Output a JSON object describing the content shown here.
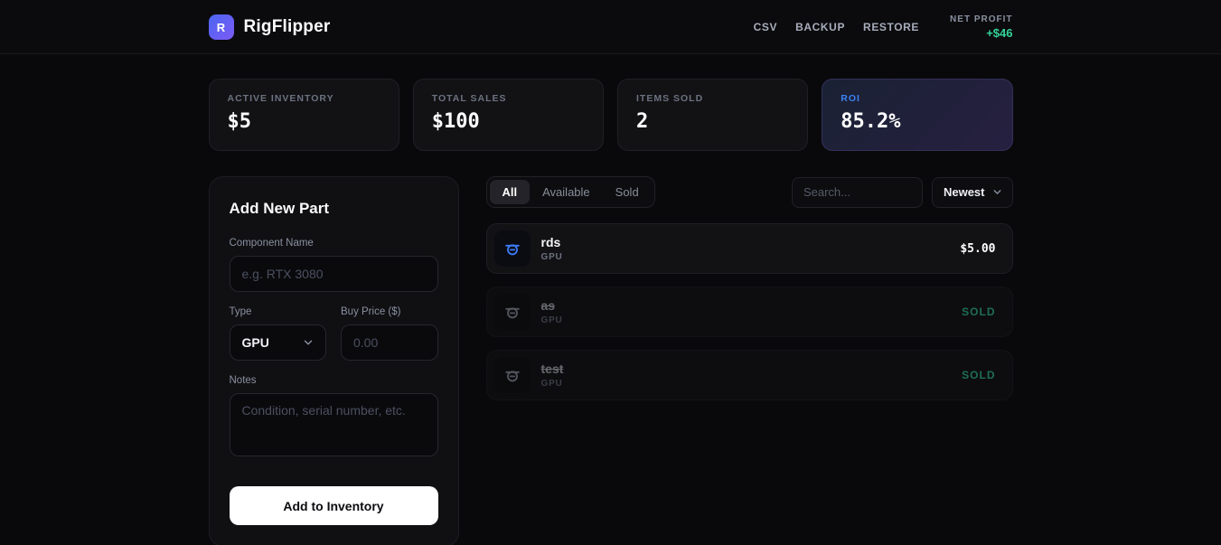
{
  "header": {
    "logo_letter": "R",
    "app_name": "RigFlipper",
    "nav": [
      {
        "label": "CSV"
      },
      {
        "label": "BACKUP"
      },
      {
        "label": "RESTORE"
      }
    ],
    "net_profit": {
      "label": "NET PROFIT",
      "value": "+$46"
    }
  },
  "stats": [
    {
      "label": "ACTIVE INVENTORY",
      "value": "$5"
    },
    {
      "label": "TOTAL SALES",
      "value": "$100"
    },
    {
      "label": "ITEMS SOLD",
      "value": "2"
    },
    {
      "label": "ROI",
      "value": "85.2%"
    }
  ],
  "form": {
    "title": "Add New Part",
    "component_name": {
      "label": "Component Name",
      "placeholder": "e.g. RTX 3080",
      "value": ""
    },
    "type": {
      "label": "Type",
      "value": "GPU"
    },
    "buy_price": {
      "label": "Buy Price ($)",
      "placeholder": "0.00",
      "value": ""
    },
    "notes": {
      "label": "Notes",
      "placeholder": "Condition, serial number, etc.",
      "value": ""
    },
    "submit_label": "Add to Inventory"
  },
  "list": {
    "tabs": [
      {
        "label": "All"
      },
      {
        "label": "Available"
      },
      {
        "label": "Sold"
      }
    ],
    "active_tab": "All",
    "search": {
      "placeholder": "Search..."
    },
    "sort": {
      "value": "Newest"
    },
    "items": [
      {
        "name": "rds",
        "type": "GPU",
        "price": "$5.00",
        "status": "available"
      },
      {
        "name": "as",
        "type": "GPU",
        "status_label": "SOLD",
        "status": "sold"
      },
      {
        "name": "test",
        "type": "GPU",
        "status_label": "SOLD",
        "status": "sold"
      }
    ]
  },
  "colors": {
    "accent_blue": "#3b82f6",
    "accent_purple": "#7c5bf5",
    "profit_green": "#34d399",
    "background": "#09090b",
    "card_background": "#121215"
  }
}
